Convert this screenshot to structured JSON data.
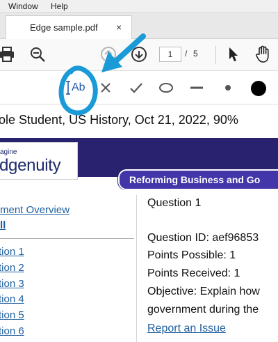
{
  "menu": {
    "items": [
      "Window",
      "Help"
    ]
  },
  "tab": {
    "title": "Edge sample.pdf",
    "close": "×"
  },
  "toolbar": {
    "page_current": "1",
    "page_separator": "/",
    "page_total": "5",
    "icons": [
      "print-icon",
      "zoom-icon",
      "page-up-icon",
      "page-down-icon",
      "select-cursor-icon",
      "hand-pan-icon"
    ]
  },
  "annotation_toolbar": {
    "text_tool_label": "Ab",
    "icons": [
      "text-box-icon",
      "cross-icon",
      "check-icon",
      "ellipse-icon",
      "line-icon",
      "small-dot-icon",
      "filled-circle-icon"
    ],
    "highlight_color": "#1a9ad6"
  },
  "document": {
    "header_line": "ole Student, US History, Oct 21, 2022, 90%",
    "logo_small": "agine",
    "logo_big": "dgenuity",
    "lesson_title": "Reforming Business and Go",
    "sidebar_links": [
      "ment Overview",
      "ll"
    ],
    "question_links": [
      "tion 1",
      "tion 2",
      "tion 3",
      "tion 4",
      "tion 5",
      "tion 6"
    ],
    "question": {
      "heading": "Question 1",
      "id_line": "Question ID: aef96853",
      "points_possible": "Points Possible: 1",
      "points_received": "Points Received: 1",
      "objective_line1": "Objective: Explain how",
      "objective_line2": "government during the",
      "report_link": "Report an Issue"
    },
    "colors": {
      "banner": "#29236f",
      "lesson_pill": "#4336a8",
      "link": "#1f5f9e"
    }
  }
}
